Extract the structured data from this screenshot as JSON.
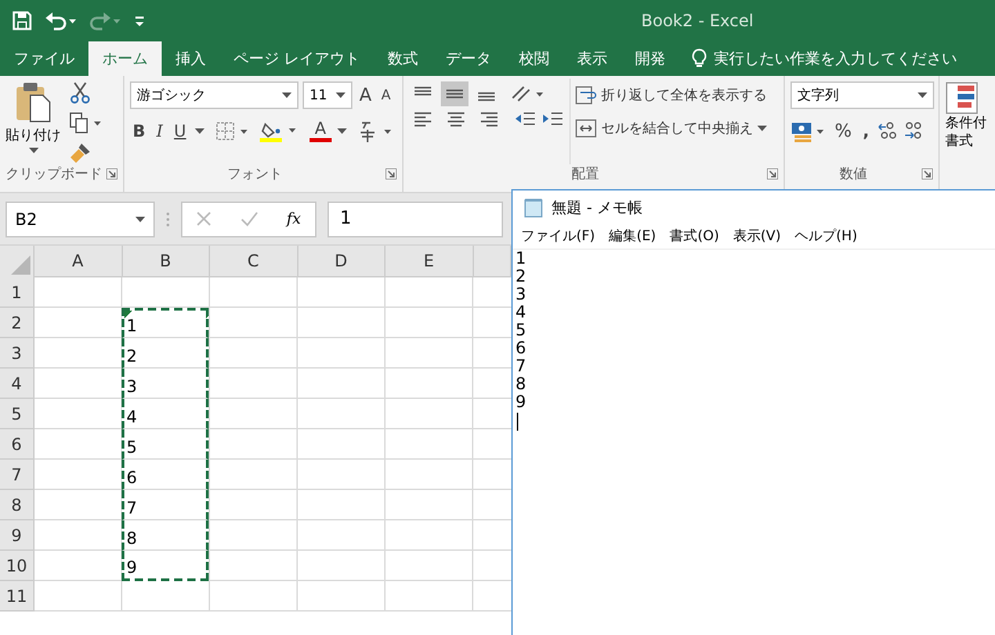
{
  "window": {
    "title": "Book2  -  Excel",
    "redo_disabled": true
  },
  "ribbon_tabs": [
    {
      "label": "ファイル",
      "selected": false
    },
    {
      "label": "ホーム",
      "selected": true
    },
    {
      "label": "挿入",
      "selected": false
    },
    {
      "label": "ページ レイアウト",
      "selected": false
    },
    {
      "label": "数式",
      "selected": false
    },
    {
      "label": "データ",
      "selected": false
    },
    {
      "label": "校閲",
      "selected": false
    },
    {
      "label": "表示",
      "selected": false
    },
    {
      "label": "開発",
      "selected": false
    }
  ],
  "tell_me": {
    "placeholder": "実行したい作業を入力してください"
  },
  "ribbon": {
    "clipboard": {
      "paste": "貼り付け",
      "label": "クリップボード"
    },
    "font": {
      "font_name": "游ゴシック",
      "font_size": "11",
      "grow": "A",
      "shrink": "A",
      "bold": "B",
      "italic": "I",
      "underline": "U",
      "font_color": "A",
      "label": "フォント"
    },
    "alignment": {
      "vertical": [
        {
          "selected": false
        },
        {
          "selected": true
        },
        {
          "selected": false
        }
      ],
      "horizontal": [
        {
          "selected": false
        },
        {
          "selected": false
        },
        {
          "selected": false
        }
      ],
      "wrap_text": "折り返して全体を表示する",
      "merge_center": "セルを結合して中央揃え",
      "label": "配置"
    },
    "number": {
      "format": "文字列",
      "percent": "%",
      "comma": ",",
      "label": "数値"
    },
    "styles": {
      "conditional_format": [
        "条件付",
        "書式"
      ]
    }
  },
  "formula_bar": {
    "name_box": "B2",
    "fx": "fx",
    "formula": "1"
  },
  "sheet": {
    "columns": [
      "A",
      "B",
      "C",
      "D",
      "E"
    ],
    "rows": [
      {
        "label": "1"
      },
      {
        "label": "2",
        "column_b": {
          "value": "1",
          "marked": true,
          "flagged": true
        }
      },
      {
        "label": "3",
        "column_b": {
          "value": "2",
          "marked": true,
          "flagged": false
        }
      },
      {
        "label": "4",
        "column_b": {
          "value": "3",
          "marked": true,
          "flagged": false
        }
      },
      {
        "label": "5",
        "column_b": {
          "value": "4",
          "marked": true,
          "flagged": false
        }
      },
      {
        "label": "6",
        "column_b": {
          "value": "5",
          "marked": true,
          "flagged": false
        }
      },
      {
        "label": "7",
        "column_b": {
          "value": "6",
          "marked": true,
          "flagged": false
        }
      },
      {
        "label": "8",
        "column_b": {
          "value": "7",
          "marked": true,
          "flagged": false
        }
      },
      {
        "label": "9",
        "column_b": {
          "value": "8",
          "marked": true,
          "flagged": false
        }
      },
      {
        "label": "10",
        "column_b": {
          "value": "9",
          "marked": true,
          "flagged": false
        }
      },
      {
        "label": "11"
      }
    ]
  },
  "notepad": {
    "title": "無題 - メモ帳",
    "menus": [
      "ファイル(F)",
      "編集(E)",
      "書式(O)",
      "表示(V)",
      "ヘルプ(H)"
    ],
    "text": "1\n2\n3\n4\n5\n6\n7\n8\n9",
    "caret": true
  }
}
